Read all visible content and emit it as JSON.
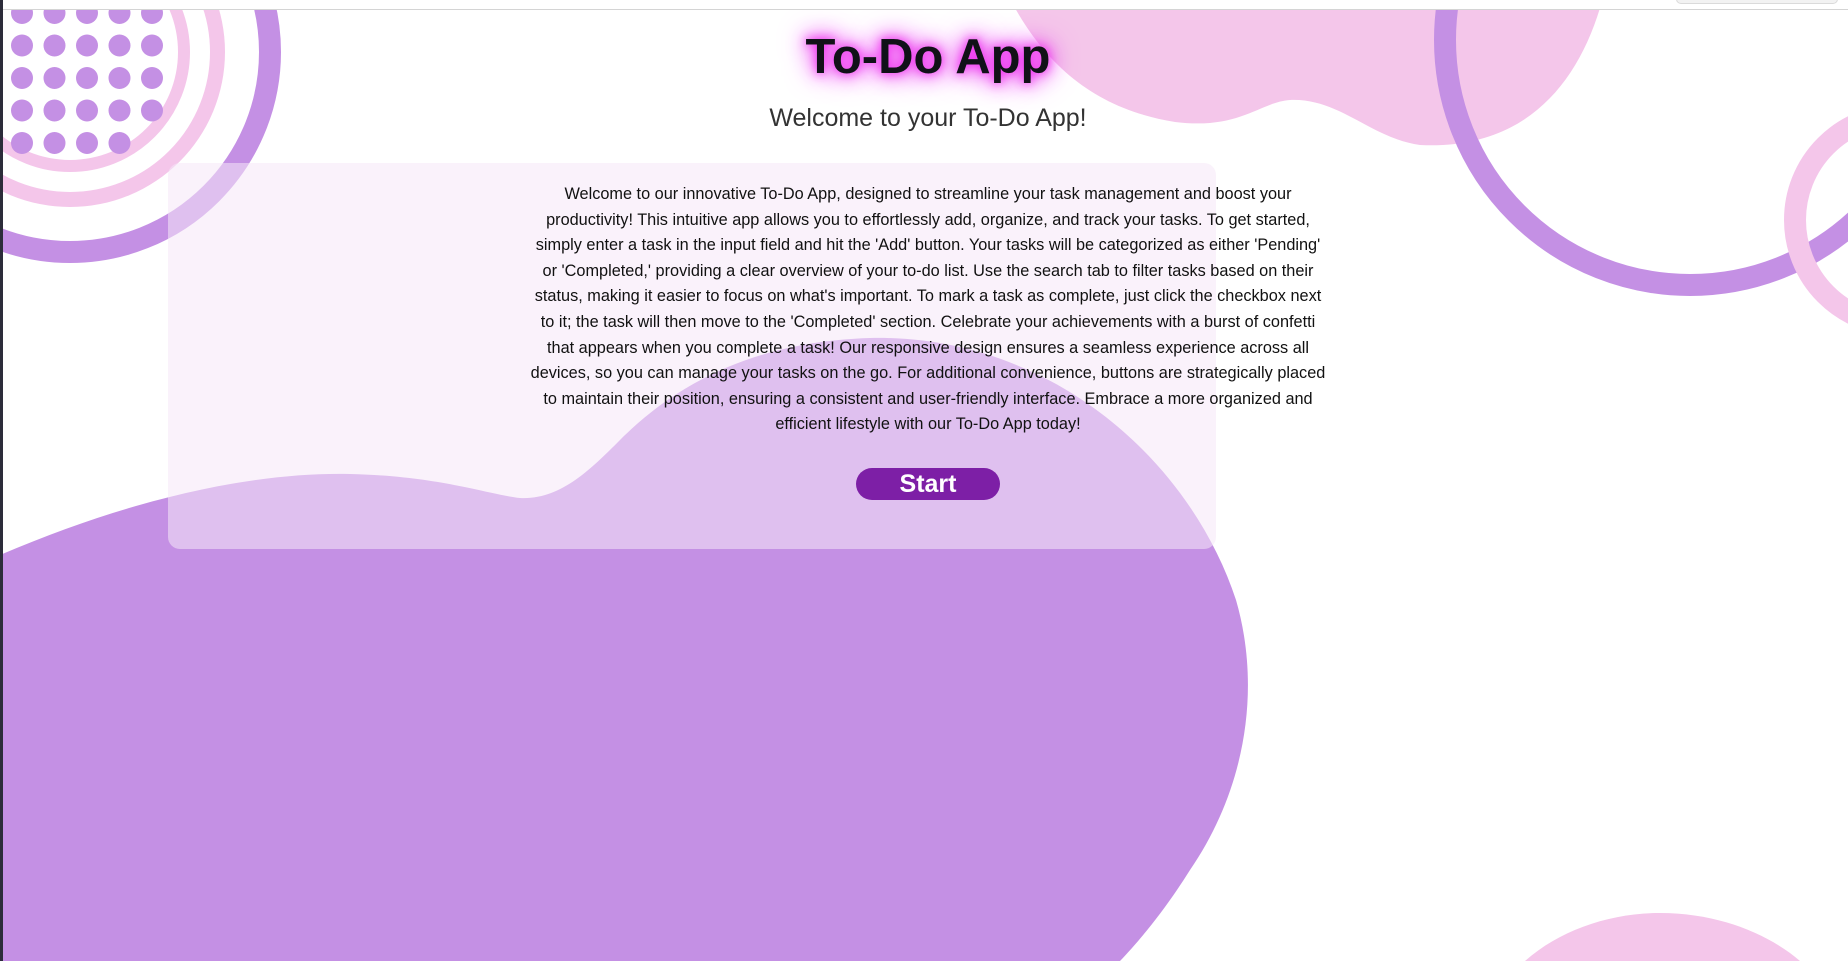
{
  "header": {
    "title": "To-Do App",
    "subtitle": "Welcome to your To-Do App!"
  },
  "main": {
    "description": "Welcome to our innovative To-Do App, designed to streamline your task management and boost your productivity! This intuitive app allows you to effortlessly add, organize, and track your tasks. To get started, simply enter a task in the input field and hit the 'Add' button. Your tasks will be categorized as either 'Pending' or 'Completed,' providing a clear overview of your to-do list. Use the search tab to filter tasks based on their status, making it easier to focus on what's important. To mark a task as complete, just click the checkbox next to it; the task will then move to the 'Completed' section. Celebrate your achievements with a burst of confetti that appears when you complete a task! Our responsive design ensures a seamless experience across all devices, so you can manage your tasks on the go. For additional convenience, buttons are strategically placed to maintain their position, ensuring a consistent and user-friendly interface. Embrace a more organized and efficient lifestyle with our To-Do App today!",
    "start_button_label": "Start"
  },
  "colors": {
    "background": "#ffffff",
    "purple_blob": "#c490e4",
    "pink_blob": "#f4c6ea",
    "card": "#f5e8f8",
    "button": "#7d1fa6",
    "title_glow": "#ee22ee"
  }
}
